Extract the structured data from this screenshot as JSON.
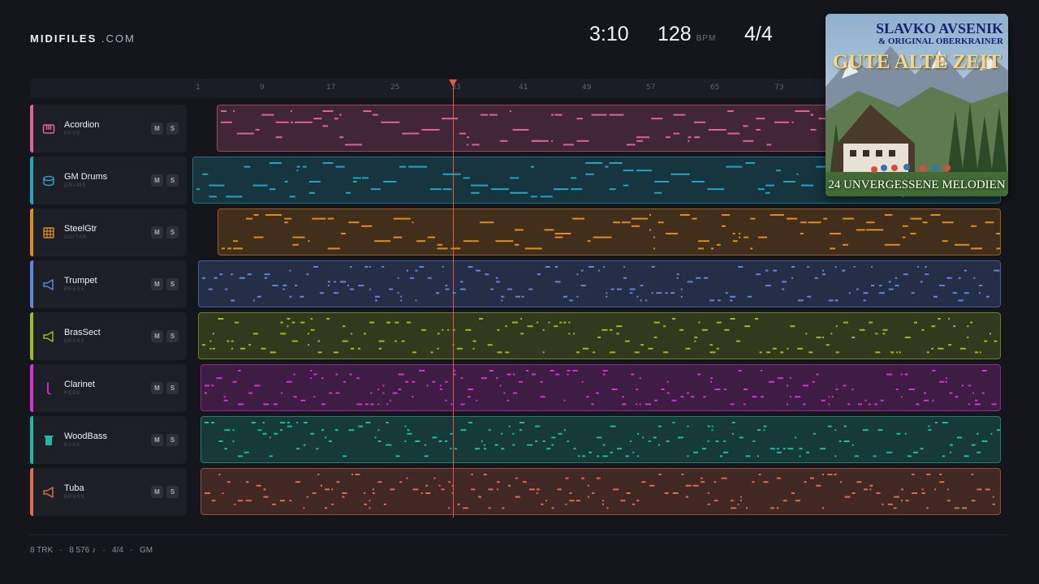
{
  "brand": {
    "name": "MIDIFILES",
    "suffix": ".COM"
  },
  "hud": {
    "time": "3:10",
    "tempo": "128",
    "tempo_unit": "BPM",
    "signature": "4/4"
  },
  "ruler": {
    "ticks": [
      "1",
      "9",
      "17",
      "25",
      "33",
      "41",
      "49",
      "57",
      "65",
      "73"
    ]
  },
  "playhead": {
    "bar": "33"
  },
  "tracks": [
    {
      "name": "Acordion",
      "category": "KEYS",
      "color": "#e2609a",
      "icon": "piano-icon",
      "mute": "M",
      "solo": "S"
    },
    {
      "name": "GM Drums",
      "category": "DRUMS",
      "color": "#21a6bf",
      "icon": "drum-icon",
      "mute": "M",
      "solo": "S"
    },
    {
      "name": "SteelGtr",
      "category": "GUITAR",
      "color": "#e28a22",
      "icon": "guitar-icon",
      "mute": "M",
      "solo": "S"
    },
    {
      "name": "Trumpet",
      "category": "BRASS",
      "color": "#5e86e0",
      "icon": "horn-icon",
      "mute": "M",
      "solo": "S"
    },
    {
      "name": "BrasSect",
      "category": "BRASS",
      "color": "#9dbb22",
      "icon": "horn-icon",
      "mute": "M",
      "solo": "S"
    },
    {
      "name": "Clarinet",
      "category": "REED",
      "color": "#d830d8",
      "icon": "clarinet-icon",
      "mute": "M",
      "solo": "S"
    },
    {
      "name": "WoodBass",
      "category": "BASS",
      "color": "#1fbba0",
      "icon": "bass-icon",
      "mute": "M",
      "solo": "S"
    },
    {
      "name": "Tuba",
      "category": "BRASS",
      "color": "#e26a4a",
      "icon": "horn-icon",
      "mute": "M",
      "solo": "S"
    }
  ],
  "album": {
    "artist": "SLAVKO AVSENIK",
    "artist_line2": "& ORIGINAL OBERKRAINER",
    "title": "GUTE ALTE ZEIT",
    "subtitle": "24 UNVERGESSENE MELODIEN"
  },
  "footer": {
    "tracks": "8 TRK",
    "notes": "8 576 ♪",
    "signature": "4/4",
    "standard": "GM",
    "sep": "·"
  }
}
